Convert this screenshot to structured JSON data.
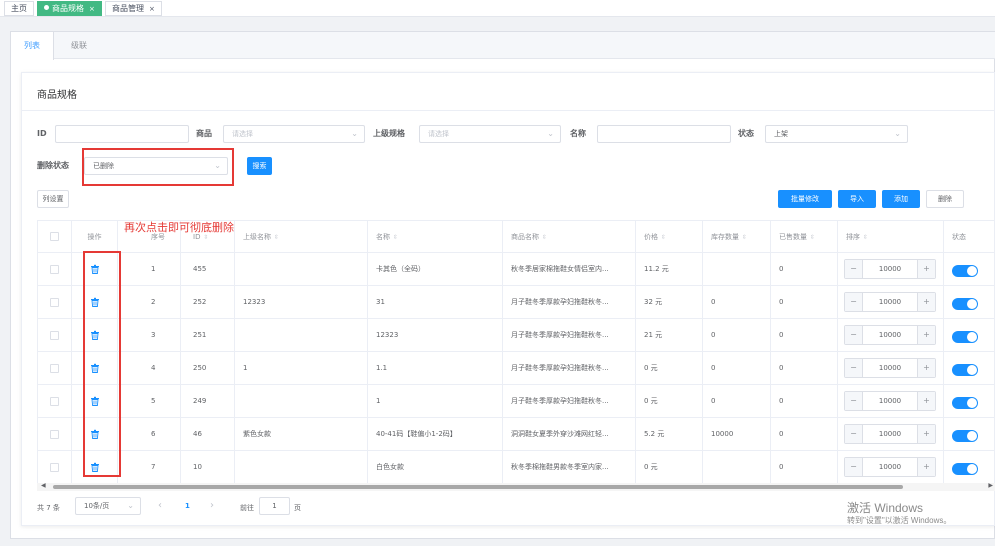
{
  "top_tabs": [
    {
      "label": "主页",
      "active": false,
      "closable": false
    },
    {
      "label": "商品规格",
      "active": true,
      "closable": true
    },
    {
      "label": "商品管理",
      "active": false,
      "closable": true
    }
  ],
  "close_glyph": "×",
  "sub_tabs": [
    {
      "label": "列表",
      "active": true
    },
    {
      "label": "级联",
      "active": false
    }
  ],
  "card_title": "商品规格",
  "filters": {
    "id_label": "ID",
    "id_value": "",
    "product_label": "商品",
    "product_placeholder": "请选择",
    "parent_spec_label": "上级规格",
    "parent_spec_placeholder": "请选择",
    "name_label": "名称",
    "name_value": "",
    "status_label": "状态",
    "status_value": "上架",
    "deleted_label": "删除状态",
    "deleted_value": "已删除",
    "search_button": "搜索"
  },
  "toolbar": {
    "column_settings": "列设置",
    "batch_edit": "批量修改",
    "import": "导入",
    "add": "添加",
    "delete": "删除"
  },
  "annotation": "再次点击即可彻底删除",
  "table": {
    "headers": [
      "操作",
      "序号",
      "ID",
      "上级名称",
      "名称",
      "商品名称",
      "价格",
      "库存数量",
      "已售数量",
      "排序",
      "状态"
    ],
    "rows": [
      {
        "seq": "1",
        "id": "455",
        "parent": "",
        "name": "卡其色（全码）",
        "product": "秋冬季居家棉拖鞋女情侣室内...",
        "price": "11.2 元",
        "stock": "",
        "sold": "0",
        "sort": "10000"
      },
      {
        "seq": "2",
        "id": "252",
        "parent": "12323",
        "name": "31",
        "product": "月子鞋冬季厚款孕妇拖鞋秋冬...",
        "price": "32 元",
        "stock": "0",
        "sold": "0",
        "sort": "10000"
      },
      {
        "seq": "3",
        "id": "251",
        "parent": "",
        "name": "12323",
        "product": "月子鞋冬季厚款孕妇拖鞋秋冬...",
        "price": "21 元",
        "stock": "0",
        "sold": "0",
        "sort": "10000"
      },
      {
        "seq": "4",
        "id": "250",
        "parent": "1",
        "name": "1.1",
        "product": "月子鞋冬季厚款孕妇拖鞋秋冬...",
        "price": "0 元",
        "stock": "0",
        "sold": "0",
        "sort": "10000"
      },
      {
        "seq": "5",
        "id": "249",
        "parent": "",
        "name": "1",
        "product": "月子鞋冬季厚款孕妇拖鞋秋冬...",
        "price": "0 元",
        "stock": "0",
        "sold": "0",
        "sort": "10000"
      },
      {
        "seq": "6",
        "id": "46",
        "parent": "紫色女款",
        "name": "40-41码【鞋偏小1-2码】",
        "product": "洞洞鞋女夏季外穿沙滩网红轻...",
        "price": "5.2 元",
        "stock": "10000",
        "sold": "0",
        "sort": "10000"
      },
      {
        "seq": "7",
        "id": "10",
        "parent": "",
        "name": "白色女款",
        "product": "秋冬季棉拖鞋男款冬季室内家...",
        "price": "0 元",
        "stock": "",
        "sold": "0",
        "sort": "10000"
      }
    ]
  },
  "stepper": {
    "minus": "−",
    "plus": "+"
  },
  "pagination": {
    "total": "共 7 条",
    "page_size": "10条/页",
    "prev": "‹",
    "current_page": "1",
    "next": "›",
    "goto_label": "前往",
    "goto_value": "1",
    "page_suffix": "页"
  },
  "watermark": {
    "line1": "激活 Windows",
    "line2": "转到\"设置\"以激活 Windows。"
  },
  "colors": {
    "primary": "#1890ff",
    "annotation": "#e53935",
    "tab_active": "#42b983"
  }
}
